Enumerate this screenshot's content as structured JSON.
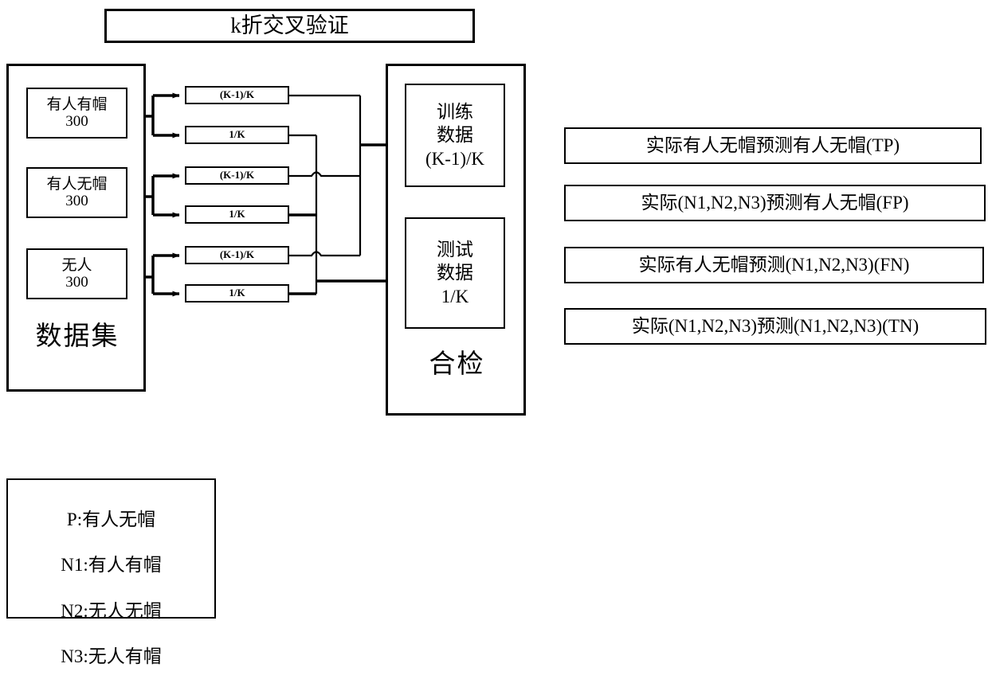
{
  "title": {
    "text": "k折交叉验证"
  },
  "dataset": {
    "label": "数据集",
    "classes": [
      {
        "name": "有人有帽",
        "count": "300"
      },
      {
        "name": "有人无帽",
        "count": "300"
      },
      {
        "name": "无人",
        "count": "300"
      }
    ]
  },
  "splits": {
    "boxes": [
      {
        "label": "(K-1)/K"
      },
      {
        "label": "1/K"
      },
      {
        "label": "(K-1)/K"
      },
      {
        "label": "1/K"
      },
      {
        "label": "(K-1)/K"
      },
      {
        "label": "1/K"
      }
    ]
  },
  "result": {
    "label": "合检",
    "boxes": [
      {
        "text": "训练\n数据\n(K-1)/K"
      },
      {
        "text": "测试\n数据\n1/K"
      }
    ]
  },
  "confusion_matrix": {
    "boxes": [
      {
        "text": "实际有人无帽预测有人无帽(TP)"
      },
      {
        "text": "实际(N1,N2,N3)预测有人无帽(FP)"
      },
      {
        "text": "实际有人无帽预测(N1,N2,N3)(FN)"
      },
      {
        "text": "实际(N1,N2,N3)预测(N1,N2,N3)(TN)"
      }
    ]
  },
  "legend": {
    "lines": [
      "P:有人无帽",
      "N1:有人有帽",
      "N2:无人无帽",
      "N3:无人有帽"
    ]
  },
  "colors": {
    "stroke": "#000000",
    "background": "#ffffff"
  }
}
